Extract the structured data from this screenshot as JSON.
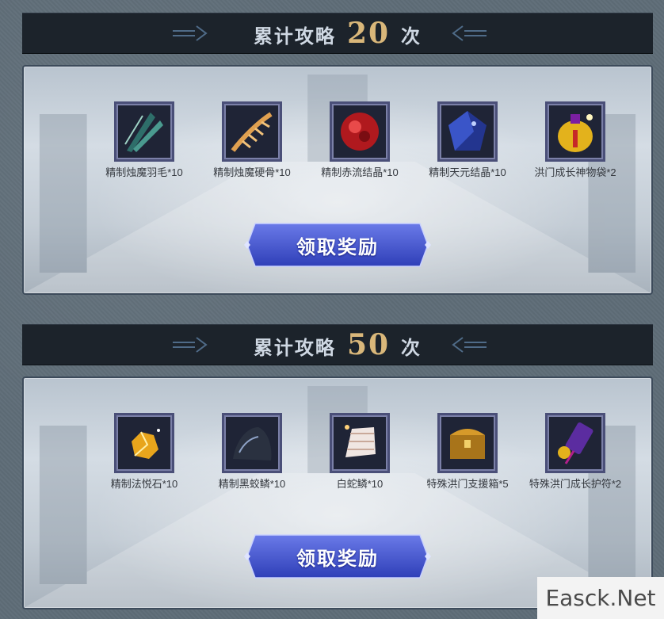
{
  "sections": [
    {
      "title_prefix": "累计攻略",
      "count": "20",
      "title_suffix": "次",
      "items": [
        {
          "label": "精制烛魔羽毛*10",
          "icon": "feather-icon"
        },
        {
          "label": "精制烛魔硬骨*10",
          "icon": "bone-icon"
        },
        {
          "label": "精制赤流结晶*10",
          "icon": "red-crystal-icon"
        },
        {
          "label": "精制天元结晶*10",
          "icon": "blue-crystal-icon"
        },
        {
          "label": "洪门成长神物袋*2",
          "icon": "treasure-bag-icon"
        }
      ],
      "button_label": "领取奖励"
    },
    {
      "title_prefix": "累计攻略",
      "count": "50",
      "title_suffix": "次",
      "items": [
        {
          "label": "精制法悦石*10",
          "icon": "gold-stone-icon"
        },
        {
          "label": "精制黑蛟鳞*10",
          "icon": "black-scale-icon"
        },
        {
          "label": "白蛇鳞*10",
          "icon": "white-scale-icon"
        },
        {
          "label": "特殊洪门支援箱*5",
          "icon": "chest-icon"
        },
        {
          "label": "特殊洪门成长护符*2",
          "icon": "amulet-icon"
        }
      ],
      "button_label": "领取奖励"
    }
  ],
  "watermark": "Easck.Net",
  "colors": {
    "title_bg": "#1c232b",
    "title_text": "#cfd8e3",
    "count_gold": "#d9b77a",
    "button_blue": "#3f51c8"
  }
}
